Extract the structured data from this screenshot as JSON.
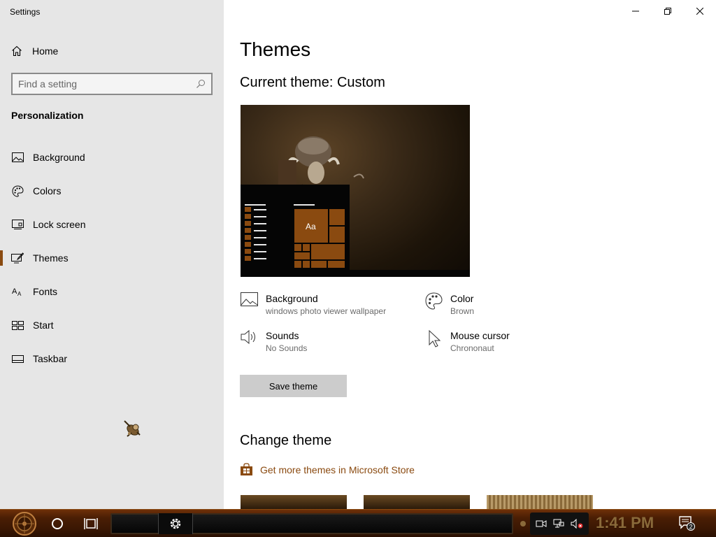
{
  "window": {
    "title": "Settings"
  },
  "sidebar": {
    "home_label": "Home",
    "search_placeholder": "Find a setting",
    "section": "Personalization",
    "items": [
      {
        "id": "background",
        "label": "Background",
        "icon": "picture-icon"
      },
      {
        "id": "colors",
        "label": "Colors",
        "icon": "palette-icon"
      },
      {
        "id": "lock-screen",
        "label": "Lock screen",
        "icon": "lock-screen-icon"
      },
      {
        "id": "themes",
        "label": "Themes",
        "icon": "themes-icon",
        "active": true
      },
      {
        "id": "fonts",
        "label": "Fonts",
        "icon": "font-icon"
      },
      {
        "id": "start",
        "label": "Start",
        "icon": "start-icon"
      },
      {
        "id": "taskbar",
        "label": "Taskbar",
        "icon": "taskbar-icon"
      }
    ]
  },
  "main": {
    "title": "Themes",
    "current_theme": "Current theme: Custom",
    "attributes": {
      "background": {
        "title": "Background",
        "value": "windows photo viewer wallpaper"
      },
      "color": {
        "title": "Color",
        "value": "Brown"
      },
      "sounds": {
        "title": "Sounds",
        "value": "No Sounds"
      },
      "mouse_cursor": {
        "title": "Mouse cursor",
        "value": "Chrononaut"
      }
    },
    "save_button": "Save theme",
    "change_theme_title": "Change theme",
    "store_link": "Get more themes in Microsoft Store",
    "preview_tile_text": "Aa"
  },
  "taskbar": {
    "clock": "1:41 PM",
    "notification_count": "2"
  },
  "colors": {
    "accent": "#8a4a10",
    "sidebar_bg": "#e6e6e6",
    "taskbar_bg": "#4a1e04"
  }
}
